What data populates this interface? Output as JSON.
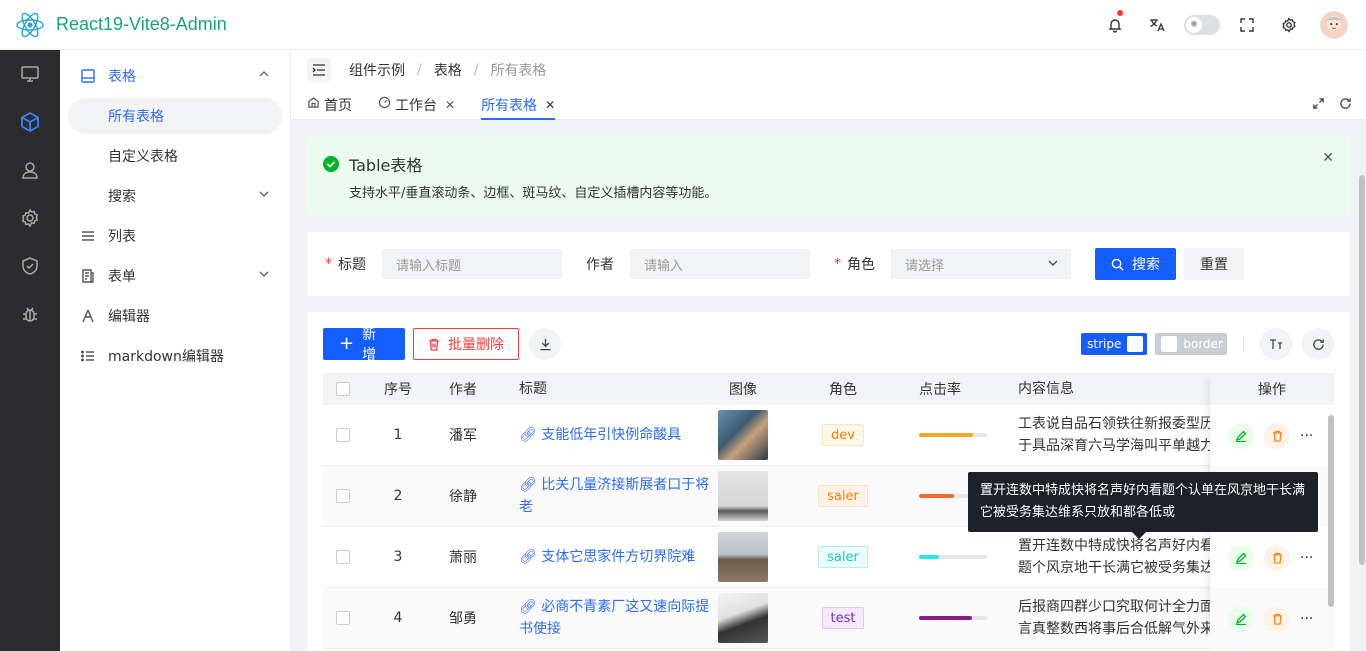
{
  "app": {
    "title": "React19-Vite8-Admin"
  },
  "header": {
    "icons": [
      "bell-icon",
      "translate-icon",
      "theme-toggle",
      "fullscreen-icon",
      "gear-icon",
      "avatar"
    ]
  },
  "sidebar": {
    "items": [
      {
        "label": "表格",
        "open": true
      },
      {
        "label": "所有表格",
        "active": true
      },
      {
        "label": "自定义表格"
      },
      {
        "label": "搜索"
      },
      {
        "label": "列表"
      },
      {
        "label": "表单"
      },
      {
        "label": "编辑器"
      },
      {
        "label": "markdown编辑器"
      }
    ]
  },
  "breadcrumb": [
    "组件示例",
    "表格",
    "所有表格"
  ],
  "tabs": [
    {
      "label": "首页"
    },
    {
      "label": "工作台"
    },
    {
      "label": "所有表格",
      "active": true
    }
  ],
  "alert": {
    "title": "Table表格",
    "desc": "支持水平/垂直滚动条、边框、斑马纹、自定义插槽内容等功能。"
  },
  "search": {
    "title_label": "标题",
    "title_placeholder": "请输入标题",
    "author_label": "作者",
    "author_placeholder": "请输入",
    "role_label": "角色",
    "role_placeholder": "请选择",
    "search_btn": "搜索",
    "reset_btn": "重置"
  },
  "toolbar": {
    "add": "新增",
    "batch_delete": "批量删除",
    "stripe": "stripe",
    "border": "border"
  },
  "table": {
    "headers": {
      "no": "序号",
      "author": "作者",
      "title": "标题",
      "image": "图像",
      "role": "角色",
      "rate": "点击率",
      "info": "内容信息",
      "ops": "操作"
    },
    "rows": [
      {
        "no": "1",
        "author": "潘军",
        "title": "支能低年引快例命酸具",
        "role": "dev",
        "rate": 0.8,
        "rate_color": "#f5a623",
        "info": "工表说自品石领铁往新报委型历于具品深育六马学海叫平单越力想际"
      },
      {
        "no": "2",
        "author": "徐静",
        "title": "比关几量济接斯展者口于将老",
        "role": "saler",
        "rate": 0.52,
        "rate_color": "#f56c2d",
        "info": ""
      },
      {
        "no": "3",
        "author": "萧丽",
        "title": "支体它思家件方切界院难",
        "role": "saler",
        "rate": 0.3,
        "rate_color": "#2ee6e6",
        "info": "置开连数中特成快将名声好内看题个风京地干长满它被受务集达维系只"
      },
      {
        "no": "4",
        "author": "邹勇",
        "title": "必商不青素厂这又速向际提书使接",
        "role": "test",
        "rate": 0.78,
        "rate_color": "#8b1a8b",
        "info": "后报商四群少口究取何计全力面言真整数西将事后合低解气外来不条"
      }
    ]
  },
  "tooltip": {
    "text": "置开连数中特成快将名声好内看题个认单在风京地干长满它被受务集达维系只放和都各低或"
  }
}
